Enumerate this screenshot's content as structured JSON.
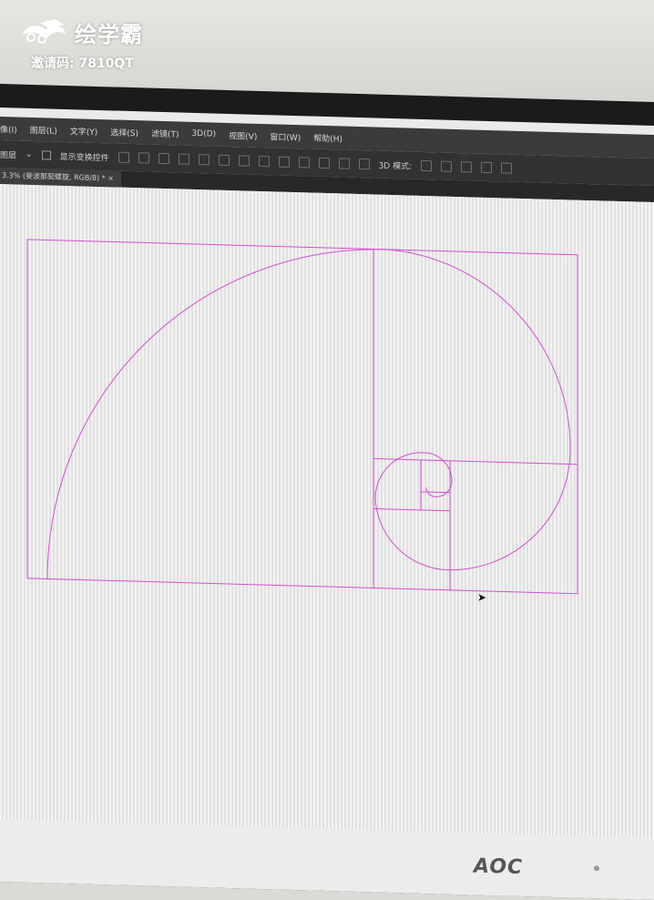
{
  "watermark": {
    "brand": "绘学霸",
    "invite": "邀请码: 7810QT"
  },
  "menubar": {
    "items": [
      "像(I)",
      "图层(L)",
      "文字(Y)",
      "选择(S)",
      "滤镜(T)",
      "3D(D)",
      "视图(V)",
      "窗口(W)",
      "帮助(H)"
    ]
  },
  "optionsbar": {
    "layer_select": "图层",
    "show_transform": "显示变换控件",
    "mode_3d": "3D 模式:"
  },
  "document": {
    "tab_title": "3.3% (斐波那契螺旋, RGB/8) * ×"
  },
  "monitor": {
    "brand": "AOC"
  },
  "colors": {
    "guide": "#d44fd1",
    "menubar": "#3b3b3b",
    "canvas": "#efefef"
  }
}
